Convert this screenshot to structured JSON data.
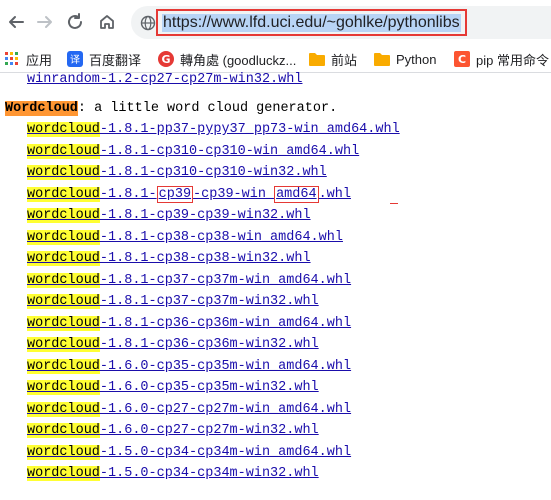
{
  "browser": {
    "url": "https://www.lfd.uci.edu/~gohlke/pythonlibs",
    "icons": {
      "back": "back-arrow-icon",
      "forward": "forward-arrow-icon",
      "reload": "reload-icon",
      "home": "home-icon",
      "site_info": "site-info-icon"
    }
  },
  "bookmarks": [
    {
      "icon": "apps-grid-icon",
      "label": "应用"
    },
    {
      "icon": "translate-icon",
      "label": "百度翻译"
    },
    {
      "icon": "g-logo-icon",
      "label": "轉角處 (goodluckz..."
    },
    {
      "icon": "folder-icon",
      "label": "前站"
    },
    {
      "icon": "folder-icon",
      "label": "Python"
    },
    {
      "icon": "c-logo-icon",
      "label": "pip 常用命令"
    }
  ],
  "content": {
    "prev_line": "winrandom‑1.2‑cp27‑cp27m‑win32.whl",
    "section": {
      "name": "Wordcloud",
      "desc": ": a little word cloud generator."
    },
    "files": [
      {
        "pkg": "wordcloud",
        "rest": "‑1.8.1‑pp37‑pypy37_pp73‑win_amd64.whl"
      },
      {
        "pkg": "wordcloud",
        "rest": "‑1.8.1‑cp310‑cp310‑win_amd64.whl"
      },
      {
        "pkg": "wordcloud",
        "rest": "‑1.8.1‑cp310‑cp310‑win32.whl"
      },
      {
        "pkg": "wordcloud",
        "rest": "‑1.8.1‑cp39‑cp39‑win_amd64.whl"
      },
      {
        "pkg": "wordcloud",
        "rest": "‑1.8.1‑cp39‑cp39‑win32.whl"
      },
      {
        "pkg": "wordcloud",
        "rest": "‑1.8.1‑cp38‑cp38‑win_amd64.whl"
      },
      {
        "pkg": "wordcloud",
        "rest": "‑1.8.1‑cp38‑cp38‑win32.whl"
      },
      {
        "pkg": "wordcloud",
        "rest": "‑1.8.1‑cp37‑cp37m‑win_amd64.whl"
      },
      {
        "pkg": "wordcloud",
        "rest": "‑1.8.1‑cp37‑cp37m‑win32.whl"
      },
      {
        "pkg": "wordcloud",
        "rest": "‑1.8.1‑cp36‑cp36m‑win_amd64.whl"
      },
      {
        "pkg": "wordcloud",
        "rest": "‑1.8.1‑cp36‑cp36m‑win32.whl"
      },
      {
        "pkg": "wordcloud",
        "rest": "‑1.6.0‑cp35‑cp35m‑win_amd64.whl"
      },
      {
        "pkg": "wordcloud",
        "rest": "‑1.6.0‑cp35‑cp35m‑win32.whl"
      },
      {
        "pkg": "wordcloud",
        "rest": "‑1.6.0‑cp27‑cp27m‑win_amd64.whl"
      },
      {
        "pkg": "wordcloud",
        "rest": "‑1.6.0‑cp27‑cp27m‑win32.whl"
      },
      {
        "pkg": "wordcloud",
        "rest": "‑1.5.0‑cp34‑cp34m‑win_amd64.whl"
      },
      {
        "pkg": "wordcloud",
        "rest": "‑1.5.0‑cp34‑cp34m‑win32.whl"
      }
    ],
    "highlighted_file": {
      "v1": "‑1.8.1‑",
      "tag1": "cp39",
      "v2": "‑cp39‑win_",
      "tag2": "amd64",
      "v3": ".whl"
    }
  }
}
